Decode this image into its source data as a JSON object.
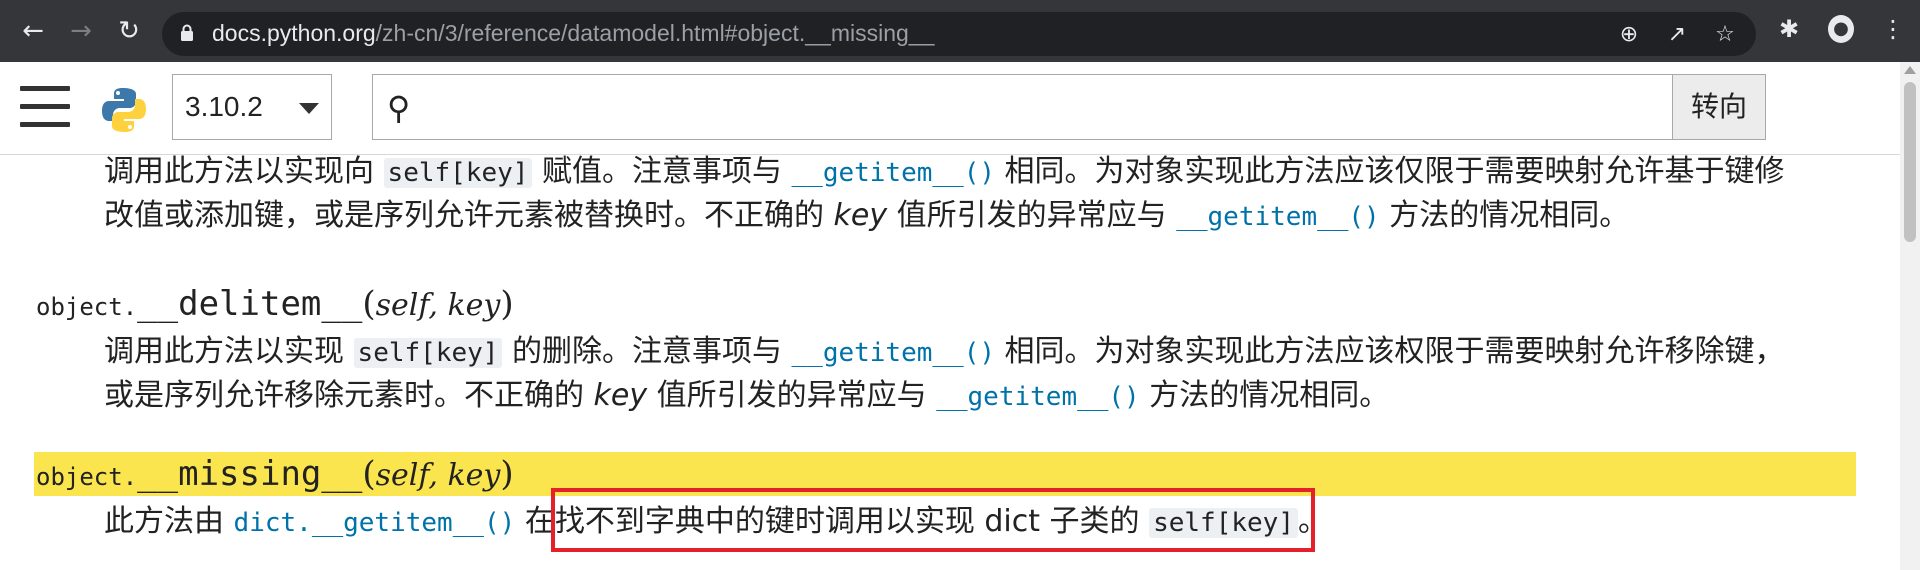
{
  "browser": {
    "url_host": "docs.python.org",
    "url_path": "/zh-cn/3/reference/datamodel.html#object.__missing__",
    "icons": [
      "back-icon",
      "forward-icon",
      "reload-icon",
      "lock-icon",
      "zoom-icon",
      "share-icon",
      "bookmark-star-icon",
      "extensions-icon",
      "profile-icon",
      "menu-dots-icon"
    ]
  },
  "header": {
    "version": "3.10.2",
    "search_value": "",
    "go_label": "转向"
  },
  "content": {
    "setitem": {
      "line1_a": "调用此方法以实现向 ",
      "line1_code": "self[key]",
      "line1_b": " 赋值。注意事项与 ",
      "line1_xref": "__getitem__()",
      "line1_c": " 相同。为对象实现此方法应该仅限于需要映射允许基于键修",
      "line2_a": "改值或添加键，或是序列允许元素被替换时。不正确的 ",
      "line2_em": "key",
      "line2_b": " 值所引发的异常应与 ",
      "line2_xref": "__getitem__()",
      "line2_c": " 方法的情况相同。"
    },
    "delitem": {
      "prefix": "object.",
      "name": "__delitem__",
      "open": "(",
      "param1": "self",
      "sep": ", ",
      "param2": "key",
      "close": ")",
      "line1_a": "调用此方法以实现 ",
      "line1_code": "self[key]",
      "line1_b": " 的删除。注意事项与 ",
      "line1_xref": "__getitem__()",
      "line1_c": " 相同。为对象实现此方法应该权限于需要映射允许移除键，",
      "line2_a": "或是序列允许移除元素时。不正确的 ",
      "line2_em": "key",
      "line2_b": " 值所引发的异常应与 ",
      "line2_xref": "__getitem__()",
      "line2_c": " 方法的情况相同。"
    },
    "missing": {
      "prefix": "object.",
      "name": "__missing__",
      "open": "(",
      "param1": "self",
      "sep": ", ",
      "param2": "key",
      "close": ")",
      "line1_a": "此方法由 ",
      "line1_xref": "dict.__getitem__()",
      "line1_b": " 在找不到字典中的键时调用以实现 dict 子类的 ",
      "line1_code": "self[key]",
      "line1_c": "。"
    }
  },
  "colors": {
    "highlight": "#fbe54e",
    "link": "#0072aa",
    "annotation_box": "#e4202a"
  }
}
